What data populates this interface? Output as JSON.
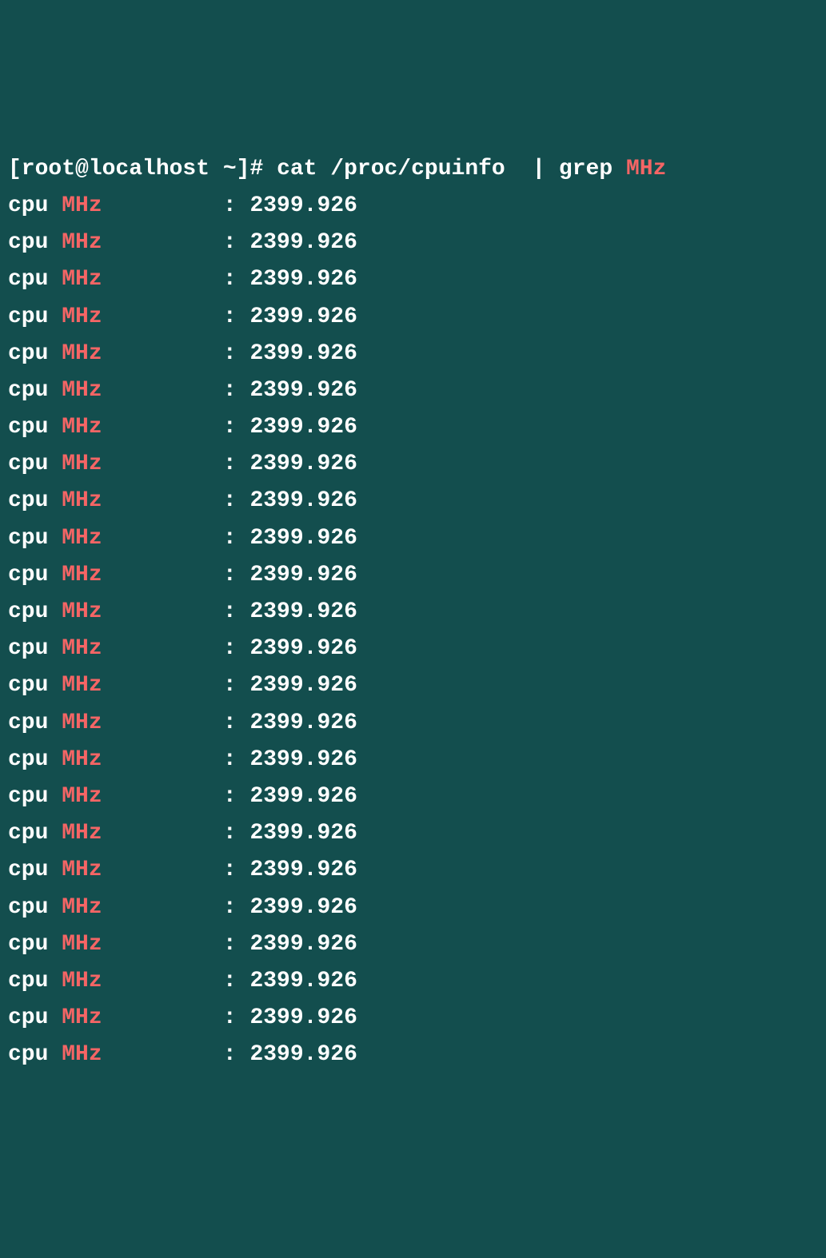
{
  "prompt": {
    "user_host": "[root@localhost ~]#",
    "command": "cat /proc/cpuinfo  | grep",
    "search_term": "MHz"
  },
  "output": {
    "field_prefix": "cpu ",
    "field_highlight": "MHz",
    "separator": "\t\t: ",
    "rows": [
      {
        "value": "2399.926"
      },
      {
        "value": "2399.926"
      },
      {
        "value": "2399.926"
      },
      {
        "value": "2399.926"
      },
      {
        "value": "2399.926"
      },
      {
        "value": "2399.926"
      },
      {
        "value": "2399.926"
      },
      {
        "value": "2399.926"
      },
      {
        "value": "2399.926"
      },
      {
        "value": "2399.926"
      },
      {
        "value": "2399.926"
      },
      {
        "value": "2399.926"
      },
      {
        "value": "2399.926"
      },
      {
        "value": "2399.926"
      },
      {
        "value": "2399.926"
      },
      {
        "value": "2399.926"
      },
      {
        "value": "2399.926"
      },
      {
        "value": "2399.926"
      },
      {
        "value": "2399.926"
      },
      {
        "value": "2399.926"
      },
      {
        "value": "2399.926"
      },
      {
        "value": "2399.926"
      },
      {
        "value": "2399.926"
      },
      {
        "value": "2399.926"
      }
    ]
  }
}
